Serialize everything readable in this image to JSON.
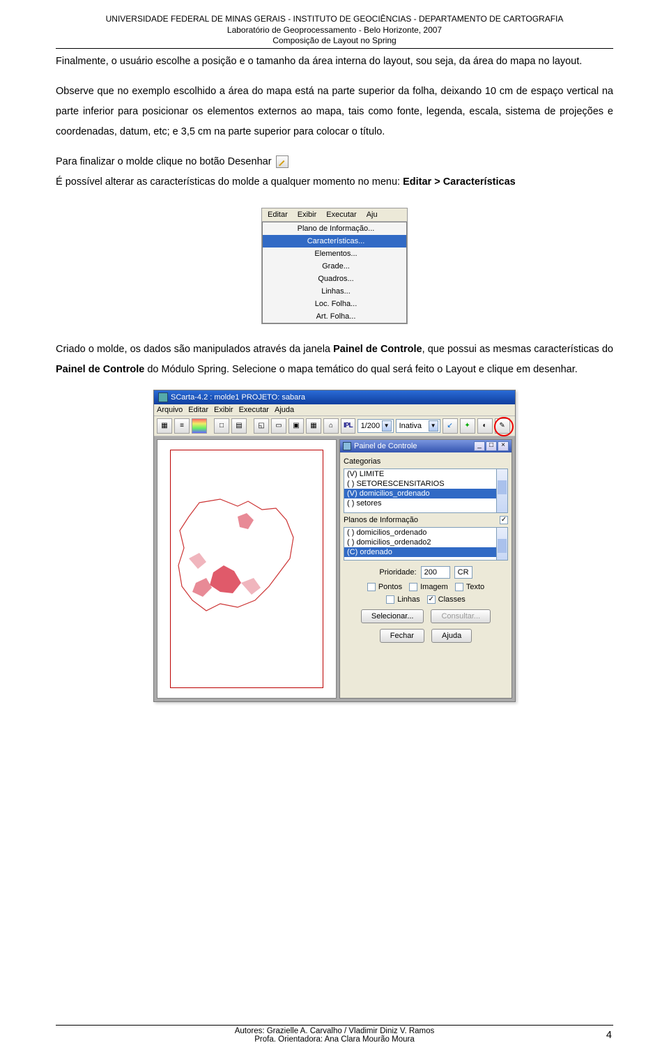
{
  "header": {
    "line1": "UNIVERSIDADE FEDERAL DE MINAS GERAIS - INSTITUTO DE GEOCIÊNCIAS - DEPARTAMENTO DE CARTOGRAFIA",
    "line2": "Laboratório de Geoprocessamento - Belo Horizonte, 2007",
    "line3": "Composição de Layout no Spring"
  },
  "para1": "Finalmente, o usuário escolhe a posição e o tamanho da área interna do layout, sou seja, da área do mapa no layout.",
  "para2": "Observe que no exemplo escolhido a área do mapa está na parte superior da folha, deixando 10 cm de espaço vertical na parte inferior para posicionar os elementos externos ao mapa, tais como fonte, legenda, escala, sistema de projeções e coordenadas, datum, etc; e 3,5 cm na parte superior para colocar o título.",
  "para3a": "Para finalizar o molde clique no botão Desenhar",
  "para3b_pre": "É possível alterar as características do molde a qualquer momento no menu: ",
  "para3b_bold": "Editar > Características",
  "menu": {
    "bar": [
      "Editar",
      "Exibir",
      "Executar",
      "Aju"
    ],
    "items": [
      "Plano de Informação...",
      "Características...",
      "Elementos...",
      "Grade...",
      "Quadros...",
      "Linhas...",
      "Loc. Folha...",
      "Art. Folha..."
    ]
  },
  "para4_pre": "Criado o molde, os dados são manipulados através da janela ",
  "para4_b1": "Painel de Controle",
  "para4_mid": ", que possui as mesmas características do ",
  "para4_b2": "Painel de Controle",
  "para4_mid2": " do Módulo Spring. Selecione o mapa temático do qual será feito o Layout e clique em desenhar.",
  "scarta": {
    "title": "SCarta-4.2 :  molde1   PROJETO: sabara",
    "menubar": [
      "Arquivo",
      "Editar",
      "Exibir",
      "Executar",
      "Ajuda"
    ],
    "zoom": "1/200",
    "cursor": "Inativa",
    "panel": {
      "title": "Painel de Controle",
      "cat_label": "Categorias",
      "categories": [
        "(V) LIMITE",
        "( ) SETORESCENSITARIOS",
        "(V) domicilios_ordenado",
        "( ) setores"
      ],
      "pi_label": "Planos de Informação",
      "pis": [
        "( ) domicilios_ordenado",
        "( ) domicilios_ordenado2",
        "(C) ordenado"
      ],
      "prioridade_label": "Prioridade:",
      "prioridade_val": "200",
      "cr": "CR",
      "chk_pontos": "Pontos",
      "chk_imagem": "Imagem",
      "chk_texto": "Texto",
      "chk_linhas": "Linhas",
      "chk_classes": "Classes",
      "btn_selecionar": "Selecionar...",
      "btn_consultar": "Consultar...",
      "btn_fechar": "Fechar",
      "btn_ajuda": "Ajuda"
    }
  },
  "footer": {
    "l1": "Autores: Grazielle A. Carvalho / Vladimir Diniz V. Ramos",
    "l2": "Profa. Orientadora: Ana Clara Mourão Moura",
    "page": "4"
  }
}
